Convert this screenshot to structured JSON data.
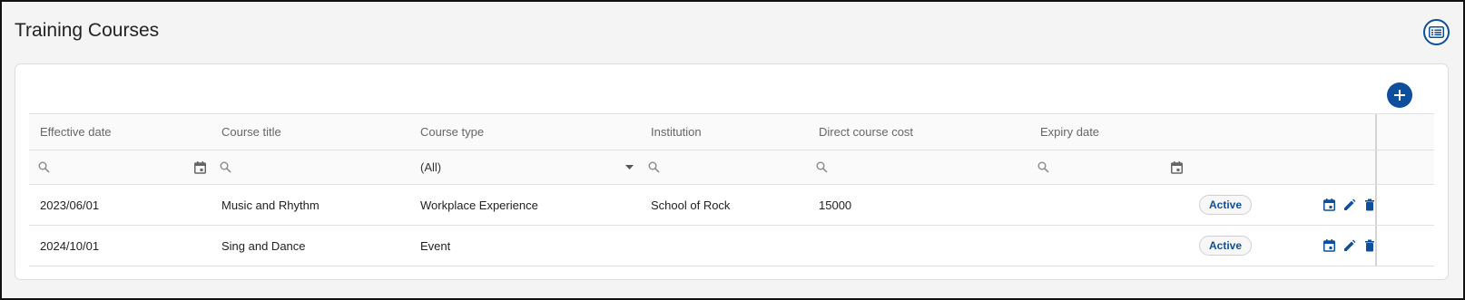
{
  "page": {
    "title": "Training Courses"
  },
  "colors": {
    "accent": "#0d4f9c",
    "icon_gray": "#888888"
  },
  "table": {
    "columns": [
      {
        "label": "Effective date"
      },
      {
        "label": "Course title"
      },
      {
        "label": "Course type"
      },
      {
        "label": "Institution"
      },
      {
        "label": "Direct course cost"
      },
      {
        "label": "Expiry date"
      }
    ],
    "filters": {
      "course_type_selected": "(All)"
    },
    "rows": [
      {
        "effective_date": "2023/06/01",
        "course_title": "Music and Rhythm",
        "course_type": "Workplace Experience",
        "institution": "School of Rock",
        "direct_course_cost": "15000",
        "expiry_date": "",
        "status": "Active"
      },
      {
        "effective_date": "2024/10/01",
        "course_title": "Sing and Dance",
        "course_type": "Event",
        "institution": "",
        "direct_course_cost": "",
        "expiry_date": "",
        "status": "Active"
      }
    ]
  },
  "icons": {
    "view_toggle": "list-view-icon",
    "add": "plus-icon",
    "filter": "search-icon",
    "date": "calendar-icon",
    "dropdown": "caret-down-icon",
    "row_actions": [
      "calendar-icon",
      "edit-icon",
      "delete-icon"
    ]
  }
}
